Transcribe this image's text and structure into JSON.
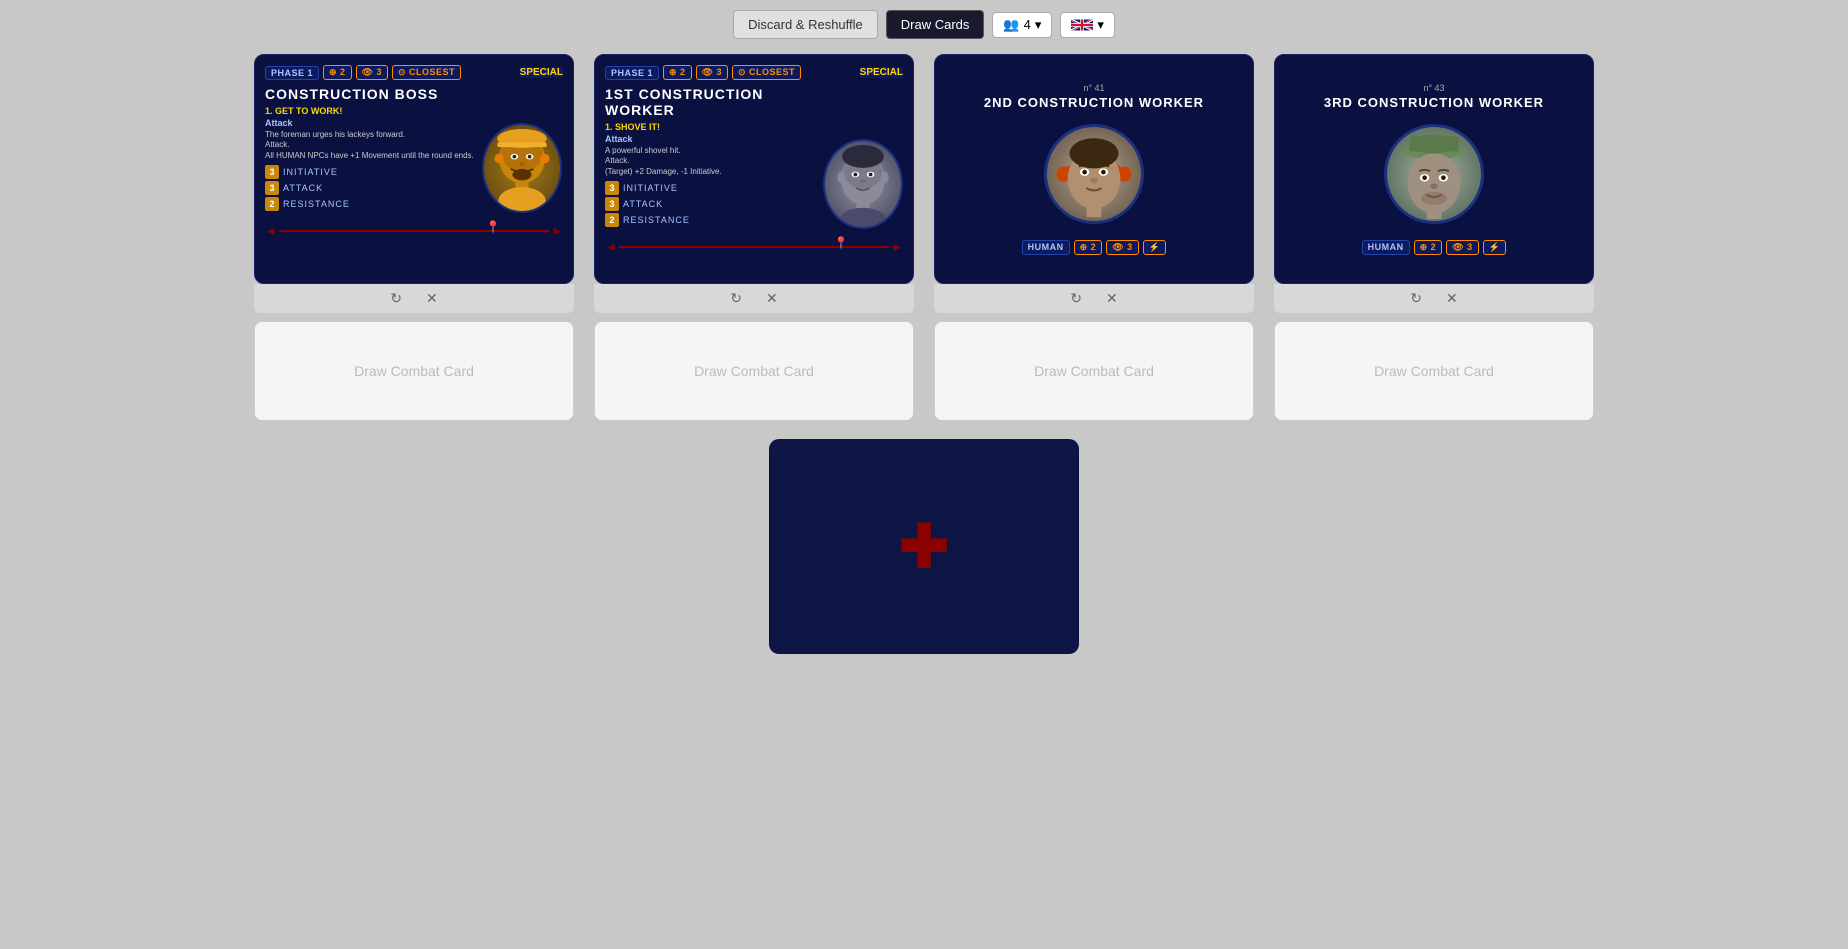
{
  "toolbar": {
    "discard_label": "Discard & Reshuffle",
    "draw_label": "Draw Cards",
    "players_count": "4",
    "lang": "EN",
    "chevron": "▾"
  },
  "enemies": [
    {
      "id": "construction-boss",
      "title": "CONSTRUCTION BOSS",
      "number": null,
      "tags": [
        "PHASE 1",
        "2",
        "3",
        "CLOSEST"
      ],
      "special_header": "SPECIAL",
      "ability1_title": "1. GET TO WORK!",
      "ability1_type": "Attack",
      "ability1_text": "The foreman urges his lackeys forward. Attack. All HUMAN NPCs have +1 Movement until the round ends.",
      "stats": [
        {
          "num": "3",
          "label": "INITIATIVE"
        },
        {
          "num": "3",
          "label": "ATTACK"
        },
        {
          "num": "2",
          "label": "RESISTANCE"
        }
      ],
      "face_class": "face-boss",
      "has_portrait": true
    },
    {
      "id": "1st-construction-worker",
      "title": "1ST CONSTRUCTION WORKER",
      "number": null,
      "tags": [
        "PHASE 1",
        "2",
        "3",
        "CLOSEST"
      ],
      "special_header": "SPECIAL",
      "ability1_title": "1. SHOVE IT!",
      "ability1_type": "Attack",
      "ability1_text": "A powerful shovel hit. Attack. (Target) +2 Damage, -1 Initiative.",
      "stats": [
        {
          "num": "3",
          "label": "INITIATIVE"
        },
        {
          "num": "3",
          "label": "ATTACK"
        },
        {
          "num": "2",
          "label": "RESISTANCE"
        }
      ],
      "face_class": "face-worker1",
      "has_portrait": true
    },
    {
      "id": "2nd-construction-worker",
      "title": "2ND CONSTRUCTION WORKER",
      "number": "n° 41",
      "tags_row": [
        "HUMAN",
        "2",
        "3",
        "⚡"
      ],
      "simple": true,
      "face_class": "face-worker2"
    },
    {
      "id": "3rd-construction-worker",
      "title": "3RD CONSTRUCTION WORKER",
      "number": "n° 43",
      "tags_row": [
        "HUMAN",
        "2",
        "3",
        "⚡"
      ],
      "simple": true,
      "face_class": "face-worker3"
    }
  ],
  "draw_cards": [
    {
      "label": "Draw Combat Card"
    },
    {
      "label": "Draw Combat Card"
    },
    {
      "label": "Draw Combat Card"
    },
    {
      "label": "Draw Combat Card"
    }
  ],
  "add_enemy": {
    "icon": "+"
  }
}
